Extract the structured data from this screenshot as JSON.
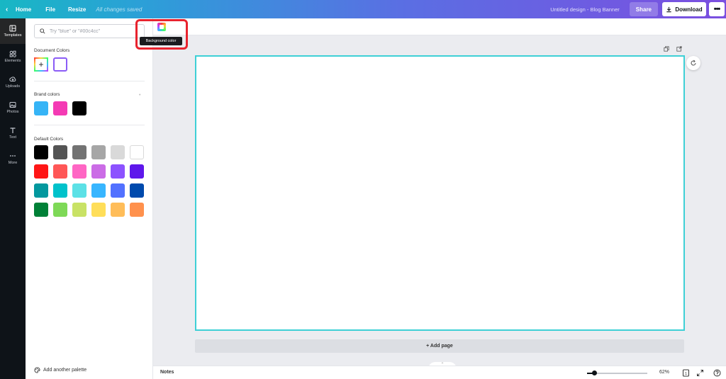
{
  "topbar": {
    "home_label": "Home",
    "file_label": "File",
    "resize_label": "Resize",
    "saved_status": "All changes saved",
    "design_title": "Untitled design - Blog Banner",
    "share_label": "Share",
    "download_label": "Download",
    "more_label": "•••"
  },
  "rail": {
    "items": [
      {
        "label": "Templates",
        "icon": "templates-icon"
      },
      {
        "label": "Elements",
        "icon": "elements-icon"
      },
      {
        "label": "Uploads",
        "icon": "uploads-icon"
      },
      {
        "label": "Photos",
        "icon": "photos-icon"
      },
      {
        "label": "Text",
        "icon": "text-icon"
      },
      {
        "label": "More",
        "icon": "more-icon"
      }
    ]
  },
  "panel": {
    "search_placeholder": "Try \"blue\" or \"#00c4cc\"",
    "document_colors_title": "Document Colors",
    "brand_colors_title": "Brand colors",
    "default_colors_title": "Default Colors",
    "add_palette_label": "Add another palette",
    "document_colors": [
      "#ffffff"
    ],
    "brand_colors": [
      "#36b4f6",
      "#f43ab4",
      "#000000"
    ],
    "default_colors": [
      [
        "#000000",
        "#545454",
        "#737373",
        "#a6a6a6",
        "#d9d9d9",
        "#ffffff"
      ],
      [
        "#ff1616",
        "#ff5757",
        "#ff66c4",
        "#cb6ce6",
        "#8c52ff",
        "#5e17eb"
      ],
      [
        "#03989e",
        "#00c2cb",
        "#5ce1e6",
        "#38b6ff",
        "#5271ff",
        "#004aad"
      ],
      [
        "#008037",
        "#7ed957",
        "#c9e265",
        "#ffde59",
        "#ffbd59",
        "#ff914d"
      ]
    ]
  },
  "editor": {
    "tooltip": "Background color",
    "add_page_label": "+ Add page"
  },
  "bottombar": {
    "notes_label": "Notes",
    "zoom_label": "62%",
    "page_count": "1"
  },
  "colors": {
    "canvas_border": "#3ed0d6",
    "highlight": "#e8232e"
  }
}
